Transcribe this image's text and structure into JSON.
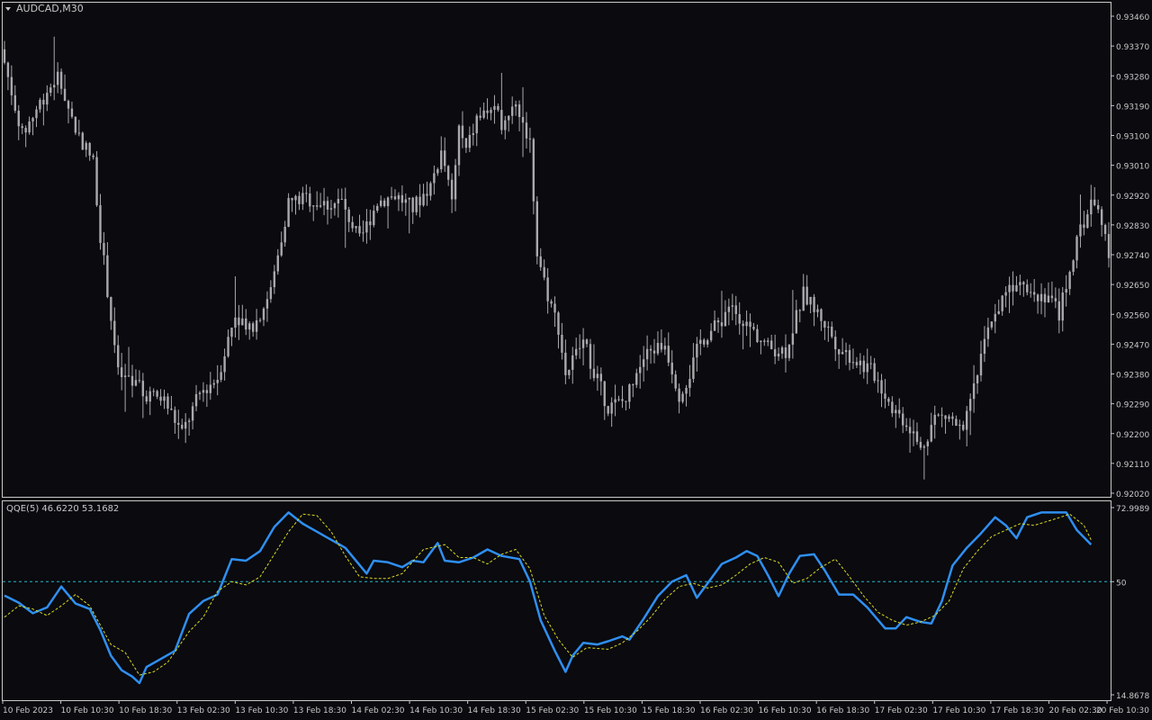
{
  "window": {
    "symbol_label": "AUDCAD,M30",
    "indicator_label": "QQE(5) 46.6220 53.1682"
  },
  "colors": {
    "background": "#0a0a0f",
    "frame": "#c8c8c8",
    "candle": "#a9a9ae",
    "qqe_line": "#2f8ff0",
    "signal_line": "#d8d820",
    "level_line": "#23b9c8",
    "text": "#c8c8c8"
  },
  "chart_data": [
    {
      "type": "candlestick",
      "symbol": "AUDCAD",
      "timeframe": "M30",
      "ylim": [
        0.9202,
        0.9346
      ],
      "y_ticks": [
        "0.93460",
        "0.93370",
        "0.93280",
        "0.93190",
        "0.93100",
        "0.93010",
        "0.92920",
        "0.92830",
        "0.92740",
        "0.92650",
        "0.92560",
        "0.92470",
        "0.92380",
        "0.92290",
        "0.92200",
        "0.92110",
        "0.92020"
      ],
      "x_ticks": [
        "10 Feb 2023",
        "10 Feb 10:30",
        "10 Feb 18:30",
        "13 Feb 02:30",
        "13 Feb 10:30",
        "13 Feb 18:30",
        "14 Feb 02:30",
        "14 Feb 10:30",
        "14 Feb 18:30",
        "15 Feb 02:30",
        "15 Feb 10:30",
        "15 Feb 18:30",
        "16 Feb 02:30",
        "16 Feb 10:30",
        "16 Feb 18:30",
        "17 Feb 02:30",
        "17 Feb 10:30",
        "17 Feb 18:30",
        "20 Feb 02:30",
        "20 Feb 10:30"
      ],
      "close_anchors": [
        [
          0,
          0.9332
        ],
        [
          5,
          0.931
        ],
        [
          10,
          0.932
        ],
        [
          15,
          0.9328
        ],
        [
          20,
          0.9312
        ],
        [
          25,
          0.9302
        ],
        [
          27,
          0.928
        ],
        [
          30,
          0.9255
        ],
        [
          32,
          0.9238
        ],
        [
          36,
          0.9235
        ],
        [
          40,
          0.9232
        ],
        [
          45,
          0.923
        ],
        [
          50,
          0.922
        ],
        [
          55,
          0.9232
        ],
        [
          60,
          0.9237
        ],
        [
          65,
          0.9256
        ],
        [
          70,
          0.9252
        ],
        [
          75,
          0.9263
        ],
        [
          80,
          0.929
        ],
        [
          85,
          0.9291
        ],
        [
          90,
          0.9289
        ],
        [
          95,
          0.929
        ],
        [
          100,
          0.9278
        ],
        [
          105,
          0.929
        ],
        [
          110,
          0.9292
        ],
        [
          115,
          0.9288
        ],
        [
          120,
          0.9295
        ],
        [
          123,
          0.9305
        ],
        [
          126,
          0.929
        ],
        [
          128,
          0.9312
        ],
        [
          130,
          0.9305
        ],
        [
          133,
          0.9315
        ],
        [
          137,
          0.9318
        ],
        [
          140,
          0.9314
        ],
        [
          144,
          0.932
        ],
        [
          148,
          0.9308
        ],
        [
          150,
          0.9275
        ],
        [
          153,
          0.9262
        ],
        [
          156,
          0.9252
        ],
        [
          158,
          0.9238
        ],
        [
          163,
          0.9248
        ],
        [
          167,
          0.9236
        ],
        [
          170,
          0.9228
        ],
        [
          175,
          0.923
        ],
        [
          178,
          0.924
        ],
        [
          182,
          0.9245
        ],
        [
          186,
          0.9247
        ],
        [
          190,
          0.9232
        ],
        [
          193,
          0.9238
        ],
        [
          196,
          0.9248
        ],
        [
          200,
          0.9252
        ],
        [
          205,
          0.9258
        ],
        [
          210,
          0.9252
        ],
        [
          215,
          0.9246
        ],
        [
          220,
          0.9245
        ],
        [
          225,
          0.9262
        ],
        [
          230,
          0.9255
        ],
        [
          235,
          0.9246
        ],
        [
          240,
          0.9242
        ],
        [
          245,
          0.9238
        ],
        [
          250,
          0.9228
        ],
        [
          255,
          0.9222
        ],
        [
          258,
          0.9215
        ],
        [
          262,
          0.9225
        ],
        [
          266,
          0.9225
        ],
        [
          270,
          0.922
        ],
        [
          274,
          0.9238
        ],
        [
          278,
          0.9255
        ],
        [
          282,
          0.9262
        ],
        [
          286,
          0.9268
        ],
        [
          290,
          0.9262
        ],
        [
          294,
          0.9262
        ],
        [
          297,
          0.9256
        ],
        [
          300,
          0.927
        ],
        [
          303,
          0.9281
        ],
        [
          306,
          0.929
        ],
        [
          309,
          0.9285
        ],
        [
          311,
          0.9274
        ]
      ],
      "high_low": {
        "high": 0.9346,
        "low": 0.9205
      }
    },
    {
      "type": "line",
      "indicator": "QQE(5)",
      "current_values": [
        46.622,
        53.1682
      ],
      "ylim": [
        14.8678,
        72.9989
      ],
      "y_ticks": [
        "72.9989",
        "50",
        "14.8678"
      ],
      "level": 50,
      "series": [
        {
          "role": "qqe",
          "points": [
            [
              0,
              45.7
            ],
            [
              4,
              43.5
            ],
            [
              8,
              40.2
            ],
            [
              12,
              42.0
            ],
            [
              16,
              48.5
            ],
            [
              20,
              43.2
            ],
            [
              24,
              41.5
            ],
            [
              27,
              35.0
            ],
            [
              30,
              27.0
            ],
            [
              33,
              22.5
            ],
            [
              36,
              20.5
            ],
            [
              38,
              18.5
            ],
            [
              40,
              23.5
            ],
            [
              44,
              26.0
            ],
            [
              48,
              28.5
            ],
            [
              52,
              40.0
            ],
            [
              56,
              44.0
            ],
            [
              60,
              46.0
            ],
            [
              64,
              57.0
            ],
            [
              68,
              56.5
            ],
            [
              72,
              59.5
            ],
            [
              76,
              67.0
            ],
            [
              80,
              71.5
            ],
            [
              84,
              68.0
            ],
            [
              88,
              65.5
            ],
            [
              92,
              63.0
            ],
            [
              96,
              60.5
            ],
            [
              102,
              52.5
            ],
            [
              104,
              56.5
            ],
            [
              108,
              56.0
            ],
            [
              112,
              54.5
            ],
            [
              115,
              56.5
            ],
            [
              118,
              56.0
            ],
            [
              122,
              62.0
            ],
            [
              124,
              56.5
            ],
            [
              128,
              56.0
            ],
            [
              132,
              57.5
            ],
            [
              136,
              60.0
            ],
            [
              140,
              58.0
            ],
            [
              145,
              57.0
            ],
            [
              148,
              50.0
            ],
            [
              151,
              38.0
            ],
            [
              155,
              28.5
            ],
            [
              158,
              22.0
            ],
            [
              160,
              27.0
            ],
            [
              163,
              31.0
            ],
            [
              167,
              30.5
            ],
            [
              170,
              31.5
            ],
            [
              174,
              33.0
            ],
            [
              176,
              32.0
            ],
            [
              180,
              38.5
            ],
            [
              184,
              45.5
            ],
            [
              188,
              50.0
            ],
            [
              192,
              52.0
            ],
            [
              195,
              45.0
            ],
            [
              198,
              49.5
            ],
            [
              202,
              55.5
            ],
            [
              206,
              57.5
            ],
            [
              209,
              59.5
            ],
            [
              212,
              58.0
            ],
            [
              215,
              52.0
            ],
            [
              218,
              45.5
            ],
            [
              221,
              52.5
            ],
            [
              224,
              58.0
            ],
            [
              228,
              58.5
            ],
            [
              231,
              53.5
            ],
            [
              235,
              46.0
            ],
            [
              239,
              46.0
            ],
            [
              243,
              42.0
            ],
            [
              248,
              35.5
            ],
            [
              251,
              35.5
            ],
            [
              254,
              39.0
            ],
            [
              258,
              37.5
            ],
            [
              261,
              37.0
            ],
            [
              264,
              44.0
            ],
            [
              267,
              55.0
            ],
            [
              271,
              60.5
            ],
            [
              275,
              65.0
            ],
            [
              279,
              70.0
            ],
            [
              282,
              67.5
            ],
            [
              285,
              63.5
            ],
            [
              288,
              70.0
            ],
            [
              292,
              71.5
            ],
            [
              296,
              71.5
            ],
            [
              299,
              71.5
            ],
            [
              302,
              66.0
            ],
            [
              306,
              61.5
            ]
          ]
        },
        {
          "role": "signal",
          "points": [
            [
              0,
              39.0
            ],
            [
              4,
              42.5
            ],
            [
              8,
              41.5
            ],
            [
              12,
              39.5
            ],
            [
              16,
              42.5
            ],
            [
              20,
              46.0
            ],
            [
              24,
              42.5
            ],
            [
              30,
              30.5
            ],
            [
              34,
              28.0
            ],
            [
              38,
              21.0
            ],
            [
              42,
              22.0
            ],
            [
              46,
              25.0
            ],
            [
              52,
              34.5
            ],
            [
              56,
              39.0
            ],
            [
              60,
              47.0
            ],
            [
              64,
              50.0
            ],
            [
              68,
              49.0
            ],
            [
              72,
              51.5
            ],
            [
              76,
              58.5
            ],
            [
              80,
              65.5
            ],
            [
              84,
              71.0
            ],
            [
              88,
              70.5
            ],
            [
              92,
              65.5
            ],
            [
              96,
              58.0
            ],
            [
              100,
              51.5
            ],
            [
              104,
              51.0
            ],
            [
              108,
              51.0
            ],
            [
              112,
              52.5
            ],
            [
              118,
              60.0
            ],
            [
              124,
              61.5
            ],
            [
              128,
              57.5
            ],
            [
              132,
              57.5
            ],
            [
              136,
              55.5
            ],
            [
              140,
              58.5
            ],
            [
              144,
              60.0
            ],
            [
              148,
              54.0
            ],
            [
              152,
              39.5
            ],
            [
              156,
              32.0
            ],
            [
              160,
              26.5
            ],
            [
              164,
              29.5
            ],
            [
              170,
              29.0
            ],
            [
              174,
              31.0
            ],
            [
              178,
              34.5
            ],
            [
              182,
              39.0
            ],
            [
              186,
              44.5
            ],
            [
              190,
              48.5
            ],
            [
              194,
              49.5
            ],
            [
              198,
              48.0
            ],
            [
              202,
              49.0
            ],
            [
              206,
              52.0
            ],
            [
              210,
              55.5
            ],
            [
              214,
              57.5
            ],
            [
              218,
              56.0
            ],
            [
              222,
              49.5
            ],
            [
              226,
              51.0
            ],
            [
              230,
              54.5
            ],
            [
              234,
              57.0
            ],
            [
              238,
              51.5
            ],
            [
              242,
              45.5
            ],
            [
              246,
              40.5
            ],
            [
              250,
              38.0
            ],
            [
              254,
              36.5
            ],
            [
              258,
              37.5
            ],
            [
              262,
              39.5
            ],
            [
              266,
              44.0
            ],
            [
              270,
              54.0
            ],
            [
              274,
              59.5
            ],
            [
              278,
              64.0
            ],
            [
              282,
              66.0
            ],
            [
              286,
              68.0
            ],
            [
              290,
              67.5
            ],
            [
              296,
              69.5
            ],
            [
              300,
              71.0
            ],
            [
              304,
              67.5
            ],
            [
              306,
              63.0
            ]
          ]
        }
      ]
    }
  ]
}
